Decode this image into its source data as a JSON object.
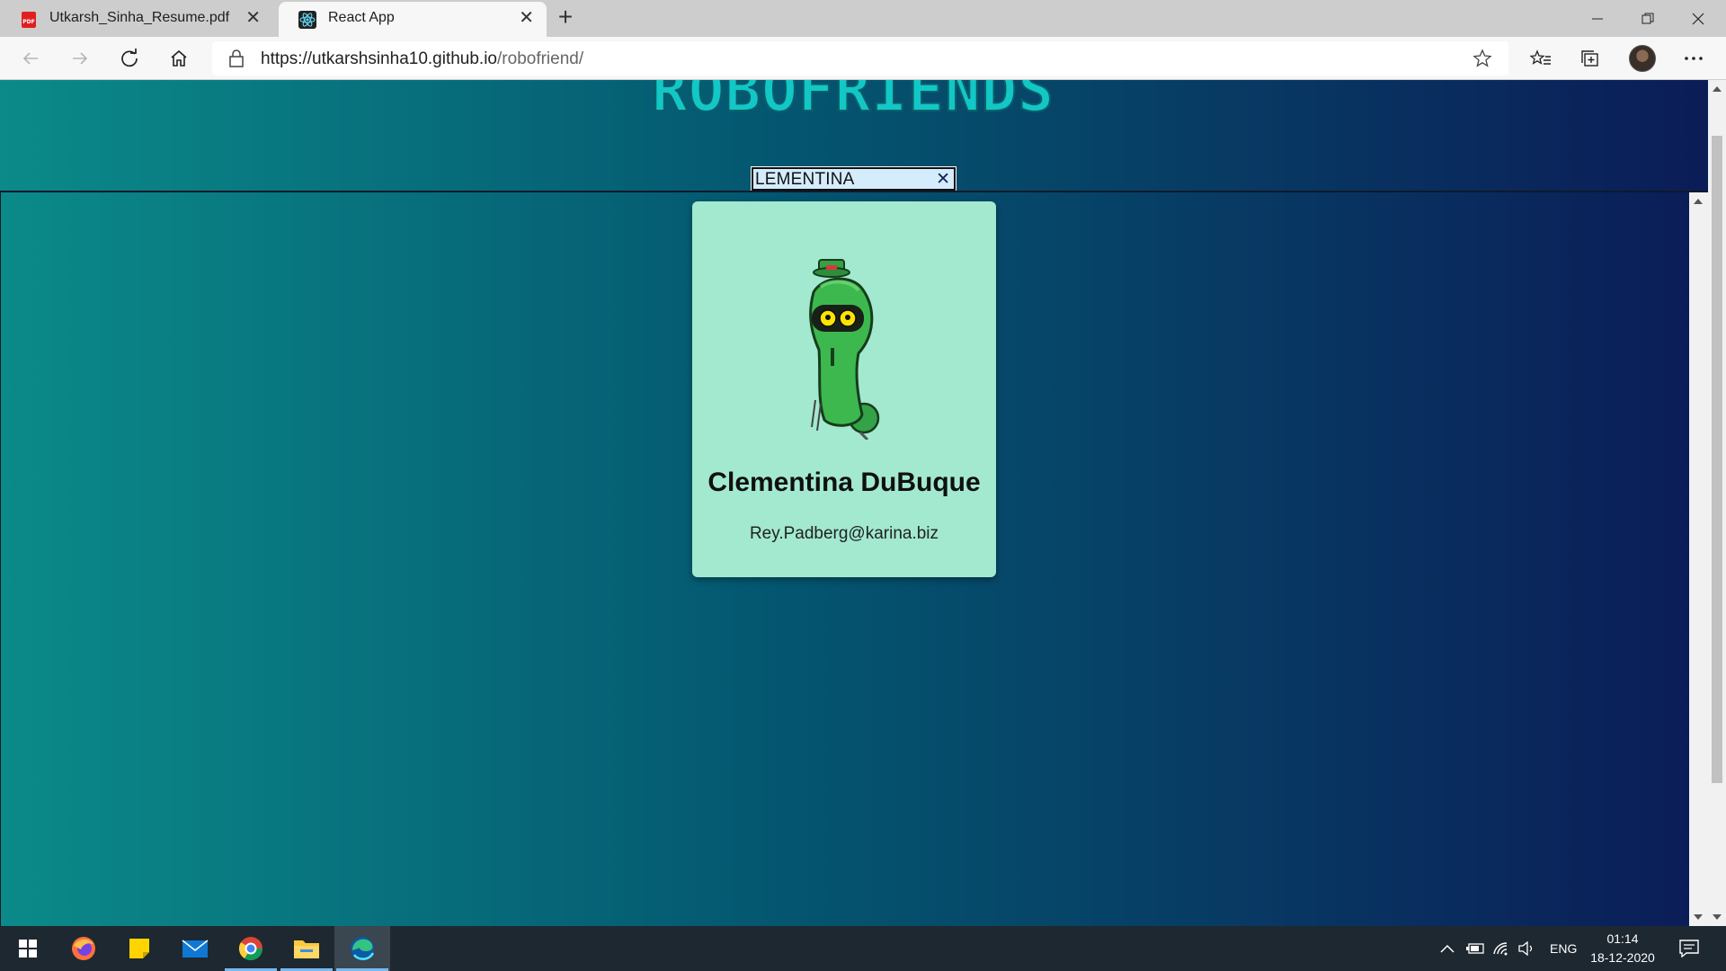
{
  "browser": {
    "tabs": [
      {
        "title": "Utkarsh_Sinha_Resume.pdf",
        "icon": "pdf-icon",
        "active": false
      },
      {
        "title": "React App",
        "icon": "react-icon",
        "active": true
      }
    ],
    "address": {
      "domain": "https://utkarshsinha10.github.io",
      "path": "/robofriend/"
    }
  },
  "page": {
    "logo_text": "ROBOFRIENDS",
    "search": {
      "value": "LEMENTINA",
      "clear_symbol": "✕"
    },
    "cards": [
      {
        "name": "Clementina DuBuque",
        "email": "Rey.Padberg@karina.biz",
        "image": "green-robot-icon"
      }
    ]
  },
  "taskbar": {
    "apps": [
      "start-icon",
      "firefox-icon",
      "sticky-notes-icon",
      "mail-icon",
      "chrome-icon",
      "file-explorer-icon",
      "edge-icon"
    ],
    "language": "ENG",
    "time": "01:14",
    "date": "18-12-2020"
  },
  "colors": {
    "gradient_left": "#0b8a89",
    "gradient_right": "#0b1c57",
    "card_bg": "#a2e9d0",
    "logo": "#12c7c5"
  }
}
